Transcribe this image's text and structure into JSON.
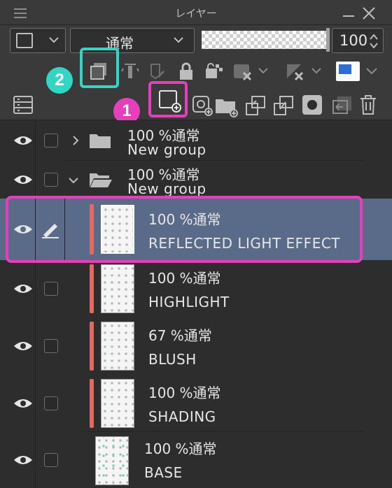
{
  "window": {
    "title": "レイヤー"
  },
  "toolbar": {
    "blend_mode": "通常",
    "opacity_value": "100",
    "opacity_fill": 1.0
  },
  "badges": {
    "one": "1",
    "two": "2"
  },
  "layers": [
    {
      "percent_mode": "100 %通常",
      "name": "New group",
      "type": "folder",
      "expanded": false
    },
    {
      "percent_mode": "100 %通常",
      "name": "New group",
      "type": "folder",
      "expanded": true
    },
    {
      "percent_mode": "100 %通常",
      "name": "REFLECTED LIGHT EFFECT",
      "type": "raster",
      "selected": true
    },
    {
      "percent_mode": "100 %通常",
      "name": "HIGHLIGHT",
      "type": "raster"
    },
    {
      "percent_mode": "67 %通常",
      "name": "BLUSH",
      "type": "raster"
    },
    {
      "percent_mode": "100 %通常",
      "name": "SHADING",
      "type": "raster"
    },
    {
      "percent_mode": "100 %通常",
      "name": "BASE",
      "type": "raster"
    }
  ],
  "colors": {
    "accent_teal": "#33d6c4",
    "accent_pink": "#e63fbc",
    "selected_row": "#5a6b8a",
    "clip_bar": "#e26a63"
  }
}
